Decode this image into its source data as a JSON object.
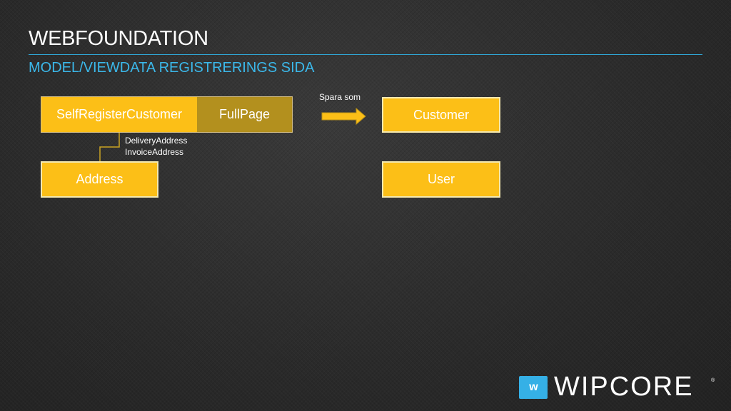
{
  "header": {
    "title": "WEBFOUNDATION",
    "subtitle": "MODEL/VIEWDATA REGISTRERINGS SIDA"
  },
  "diagram": {
    "nodes": {
      "self_register_customer": "SelfRegisterCustomer",
      "full_page": "FullPage",
      "address": "Address",
      "customer": "Customer",
      "user": "User"
    },
    "relation_labels": [
      "DeliveryAddress",
      "InvoiceAddress"
    ],
    "arrow_label": "Spara som"
  },
  "logo": {
    "badge_letter": "w",
    "word": "WIPCORE",
    "reg_mark": "®"
  },
  "colors": {
    "background": "#2b2b2b",
    "accent_blue": "#3bb8ea",
    "box_yellow": "#fcbf17",
    "box_olive": "#b3901e",
    "text": "#ffffff"
  }
}
